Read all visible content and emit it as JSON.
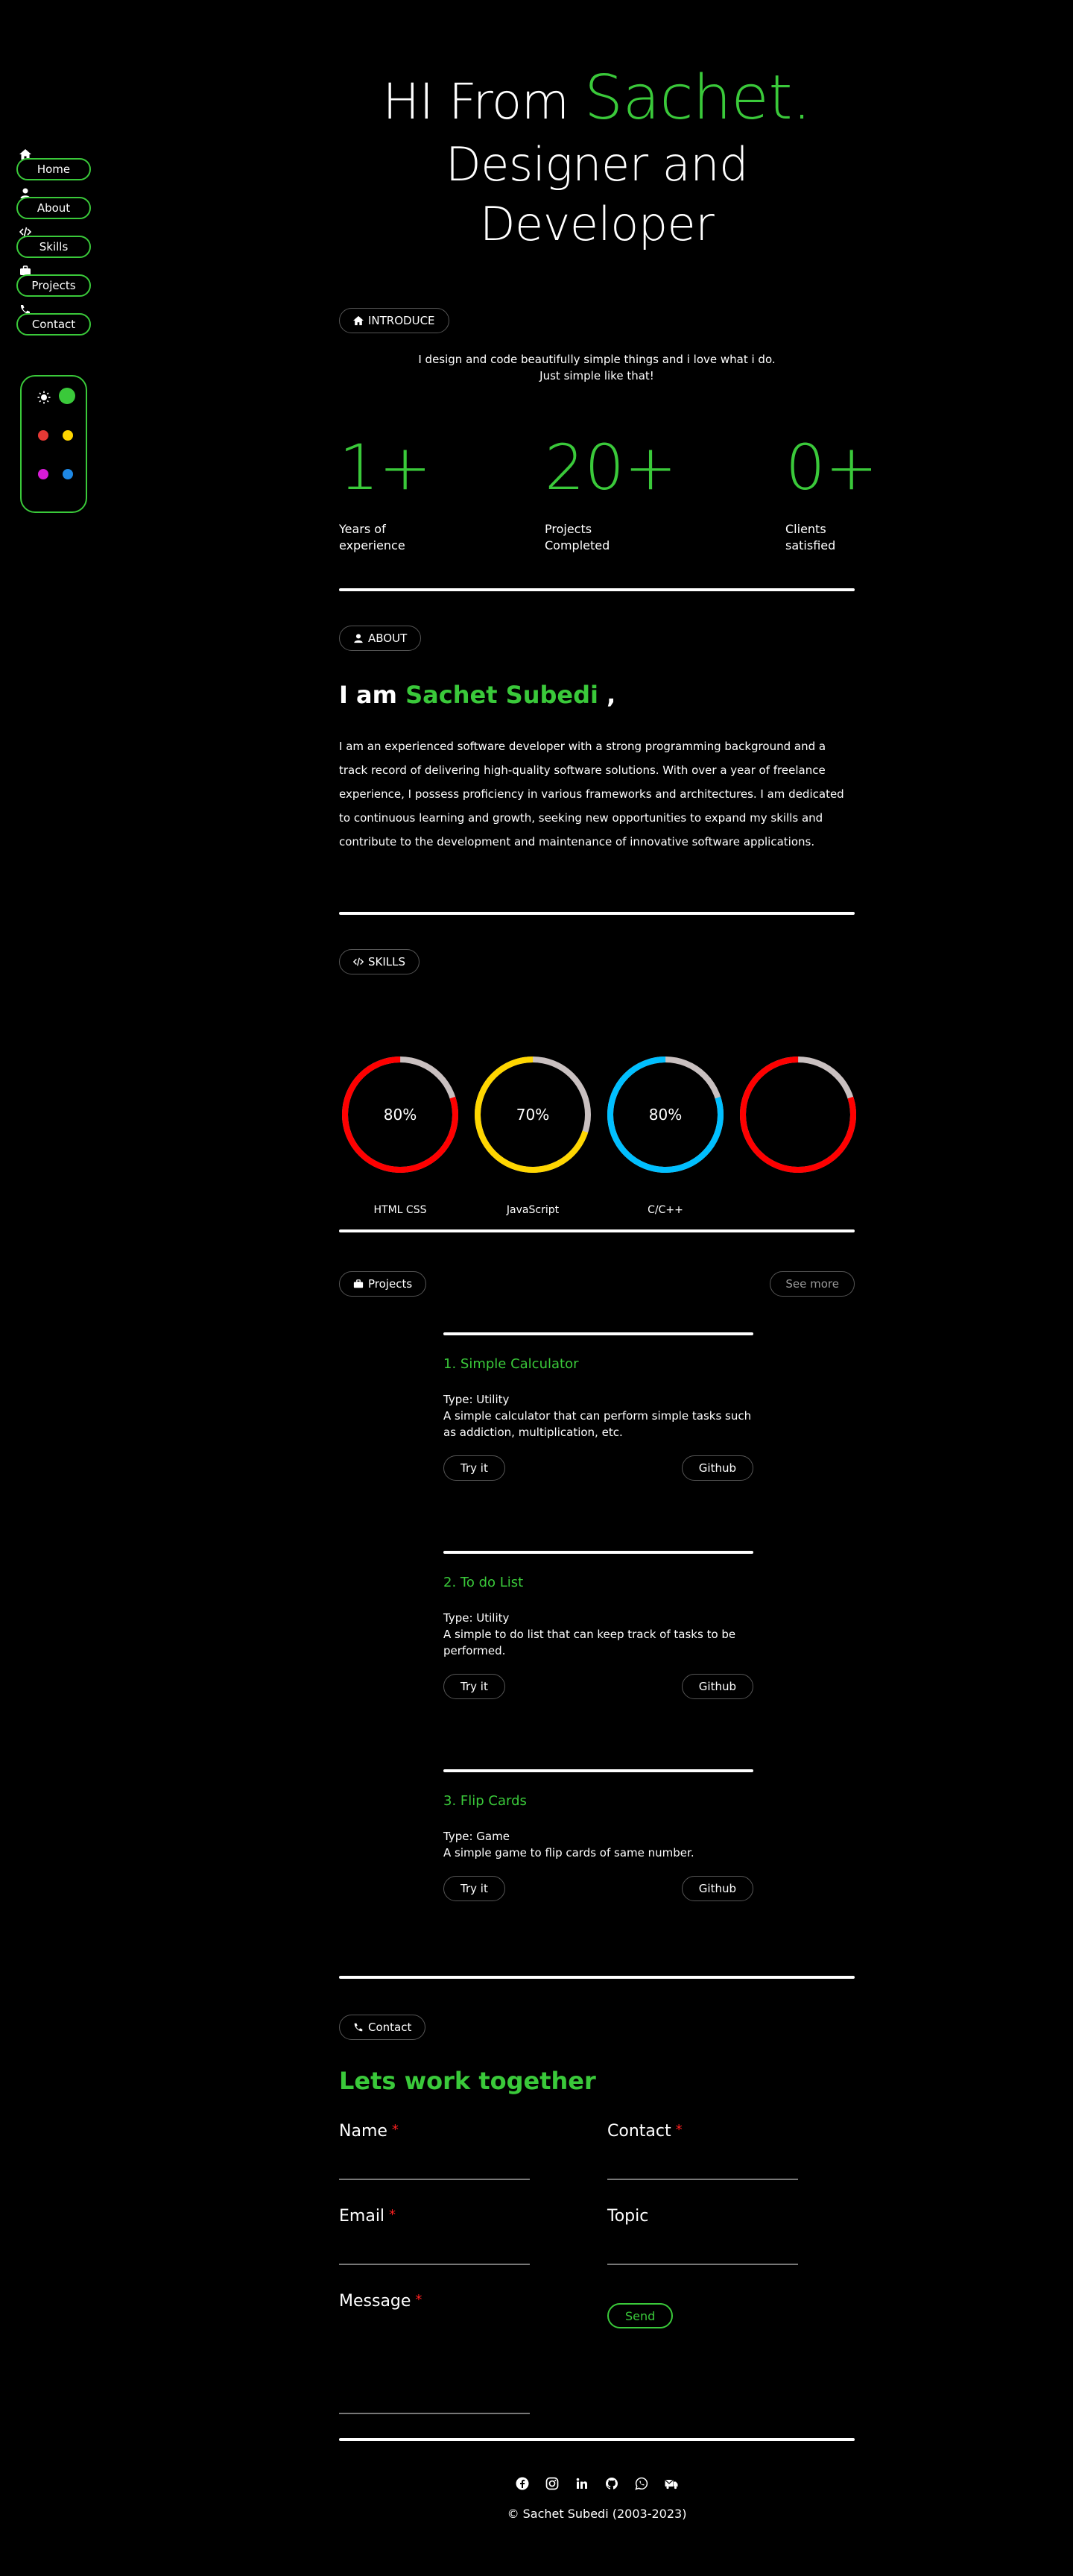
{
  "nav": {
    "items": [
      {
        "label": "Home",
        "icon": "home-icon"
      },
      {
        "label": "About",
        "icon": "user-icon"
      },
      {
        "label": "Skills",
        "icon": "code-icon"
      },
      {
        "label": "Projects",
        "icon": "briefcase-icon"
      },
      {
        "label": "Contact",
        "icon": "phone-icon"
      }
    ],
    "theme_colors": {
      "active": "#3ac93a",
      "options": [
        "#e53935",
        "#ffd600",
        "#d81bd8",
        "#1e88e5"
      ]
    }
  },
  "hero": {
    "greeting": "HI From",
    "name": "Sachet.",
    "subtitle": "Designer and Developer"
  },
  "introduce": {
    "tag": "INTRODUCE",
    "line1": "I design and code beautifully simple things and i love what i do.",
    "line2": "Just simple like that!"
  },
  "stats": [
    {
      "value": "1+",
      "line1": "Years of",
      "line2": "experience"
    },
    {
      "value": "20+",
      "line1": "Projects",
      "line2": "Completed"
    },
    {
      "value": "0+",
      "line1": "Clients",
      "line2": "satisfied"
    }
  ],
  "about": {
    "tag": "ABOUT",
    "prefix": "I am",
    "name": "Sachet Subedi",
    "suffix": ",",
    "text": "I am an experienced software developer with a strong programming background and a track record of delivering high-quality software solutions. With over a year of freelance experience, I possess proficiency in various frameworks and architectures. I am dedicated to continuous learning and growth, seeking new opportunities to expand my skills and contribute to the development and maintenance of innovative software applications."
  },
  "skills": {
    "tag": "SKILLS",
    "items": [
      {
        "name": "HTML CSS",
        "percent_label": "80%",
        "value": 0.8,
        "color": "#ff0000"
      },
      {
        "name": "JavaScript",
        "percent_label": "70%",
        "value": 0.7,
        "color": "#ffd600"
      },
      {
        "name": "C/C++",
        "percent_label": "80%",
        "value": 0.8,
        "color": "#00bfff"
      },
      {
        "name": "",
        "percent_label": "",
        "value": 0.8,
        "color": "#ff0000"
      }
    ]
  },
  "projects": {
    "tag": "Projects",
    "see_more": "See more",
    "items": [
      {
        "title": "1. Simple Calculator",
        "type": "Type: Utility",
        "desc": "A simple calculator that can perform simple tasks such as addiction, multiplication, etc.",
        "try": "Try it",
        "github": "Github"
      },
      {
        "title": "2. To do List",
        "type": "Type: Utility",
        "desc": "A simple to do list that can keep track of tasks to be performed.",
        "try": "Try it",
        "github": "Github"
      },
      {
        "title": "3. Flip Cards",
        "type": "Type: Game",
        "desc": "A simple game to flip cards of same number.",
        "try": "Try it",
        "github": "Github"
      }
    ]
  },
  "contact": {
    "tag": "Contact",
    "title": "Lets work together",
    "fields": {
      "name": "Name",
      "contact": "Contact",
      "email": "Email",
      "topic": "Topic",
      "message": "Message"
    },
    "required_mark": "*",
    "send": "Send"
  },
  "footer": {
    "social_icons": [
      "facebook-icon",
      "instagram-icon",
      "linkedin-icon",
      "github-icon",
      "whatsapp-icon",
      "mail-icon"
    ],
    "copyright": "© Sachet Subedi (2003-2023)"
  }
}
